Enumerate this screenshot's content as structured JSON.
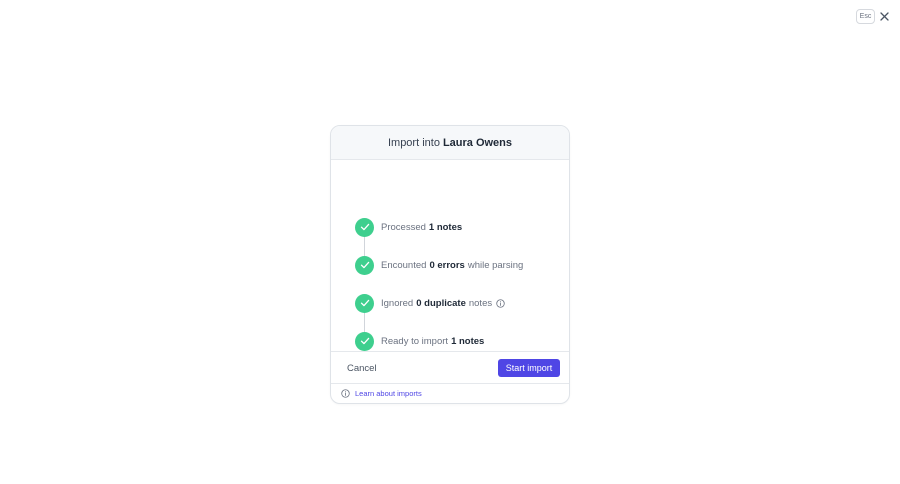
{
  "topbar": {
    "esc_label": "Esc"
  },
  "modal": {
    "title_prefix": "Import into",
    "title_name": "Laura Owens",
    "steps": [
      {
        "pre": "Processed",
        "bold": "1 notes",
        "post": ""
      },
      {
        "pre": "Encounted",
        "bold": "0 errors",
        "post": "while parsing"
      },
      {
        "pre": "Ignored",
        "bold": "0 duplicate",
        "post": "notes"
      },
      {
        "pre": "Ready to import",
        "bold": "1 notes",
        "post": ""
      }
    ],
    "cancel_label": "Cancel",
    "start_label": "Start import",
    "learn_label": "Learn about imports"
  },
  "colors": {
    "accent": "#4f46e5",
    "success": "#3ecf8e"
  },
  "icons": [
    "close-icon",
    "check-icon",
    "info-icon"
  ]
}
